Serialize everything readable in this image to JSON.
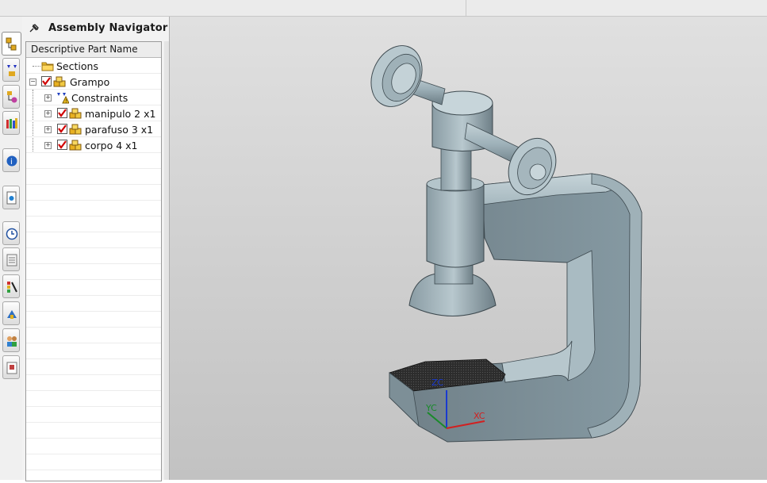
{
  "navigator": {
    "title": "Assembly Navigator",
    "column_header": "Descriptive Part Name",
    "items": [
      {
        "label": "Sections",
        "icon": "folder-icon",
        "level": 0
      },
      {
        "label": "Grampo",
        "icon": "assembly-icon",
        "checked": true,
        "expanded": true,
        "level": 0
      },
      {
        "label": "Constraints",
        "icon": "constraints-icon",
        "level": 1
      },
      {
        "label": "manipulo 2 x1",
        "icon": "component-icon",
        "checked": true,
        "level": 1
      },
      {
        "label": "parafuso 3 x1",
        "icon": "component-icon",
        "checked": true,
        "level": 1
      },
      {
        "label": "corpo 4 x1",
        "icon": "component-icon",
        "checked": true,
        "level": 1
      }
    ]
  },
  "resource_bar": {
    "buttons": [
      "assembly-navigator-icon",
      "constraint-navigator-icon",
      "part-navigator-icon",
      "reuse-library-icon",
      "hd3d-tools-icon",
      "web-browser-icon",
      "history-icon",
      "system-materials-icon",
      "visualization-icon",
      "process-studio-icon",
      "roles-icon",
      "reports-icon"
    ]
  },
  "triad": {
    "zc": "ZC",
    "yc": "YC",
    "xc": "XC"
  },
  "colors": {
    "model": "#7b8c94",
    "model_light": "#b9c8ce",
    "background": "#cfcfcf",
    "jaw": "#2a2a2a",
    "xc": "#d22020",
    "yc": "#1a8a2a",
    "zc": "#1a3ad0"
  }
}
